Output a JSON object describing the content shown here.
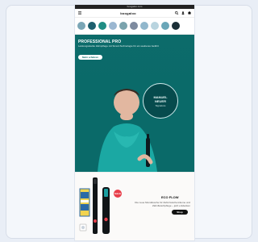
{
  "browser": {
    "url": "boogaloo.com"
  },
  "app": {
    "brand": "boogaloo"
  },
  "hero": {
    "title": "PROFESSIONAL PRO",
    "subtitle": "Leistungsstarke Zahnpflege mit Smart-Technologie für ein sauberes Gefühl.",
    "cta": "Mehr erfahren",
    "badge_line1": "MANUEL",
    "badge_line2": "NEUER",
    "badge_line3": "Signature"
  },
  "product": {
    "sale_badge": "SALE",
    "title": "ECO FLOW",
    "description": "Die neue Munddusche für Zahnzwischenräume und Zahnfleischpflege – jetzt entdecken",
    "cta": "Shop"
  },
  "colors": {
    "hero_bg": "#0a6a69",
    "accent_red": "#e83f4b",
    "cta_dark": "#111111"
  },
  "icons": {
    "menu": "menu-icon",
    "search": "search-icon",
    "account": "user-icon",
    "cart": "cart-icon"
  },
  "categories": [
    {
      "color": "#7aa6b6"
    },
    {
      "color": "#1d5f6e"
    },
    {
      "color": "#1f8d84"
    },
    {
      "color": "#9bb7d1"
    },
    {
      "color": "#7aa3ad"
    },
    {
      "color": "#7e8b9f"
    },
    {
      "color": "#91b7cc"
    },
    {
      "color": "#b9d4df"
    },
    {
      "color": "#6aa6b8"
    },
    {
      "color": "#1b2f37"
    }
  ]
}
